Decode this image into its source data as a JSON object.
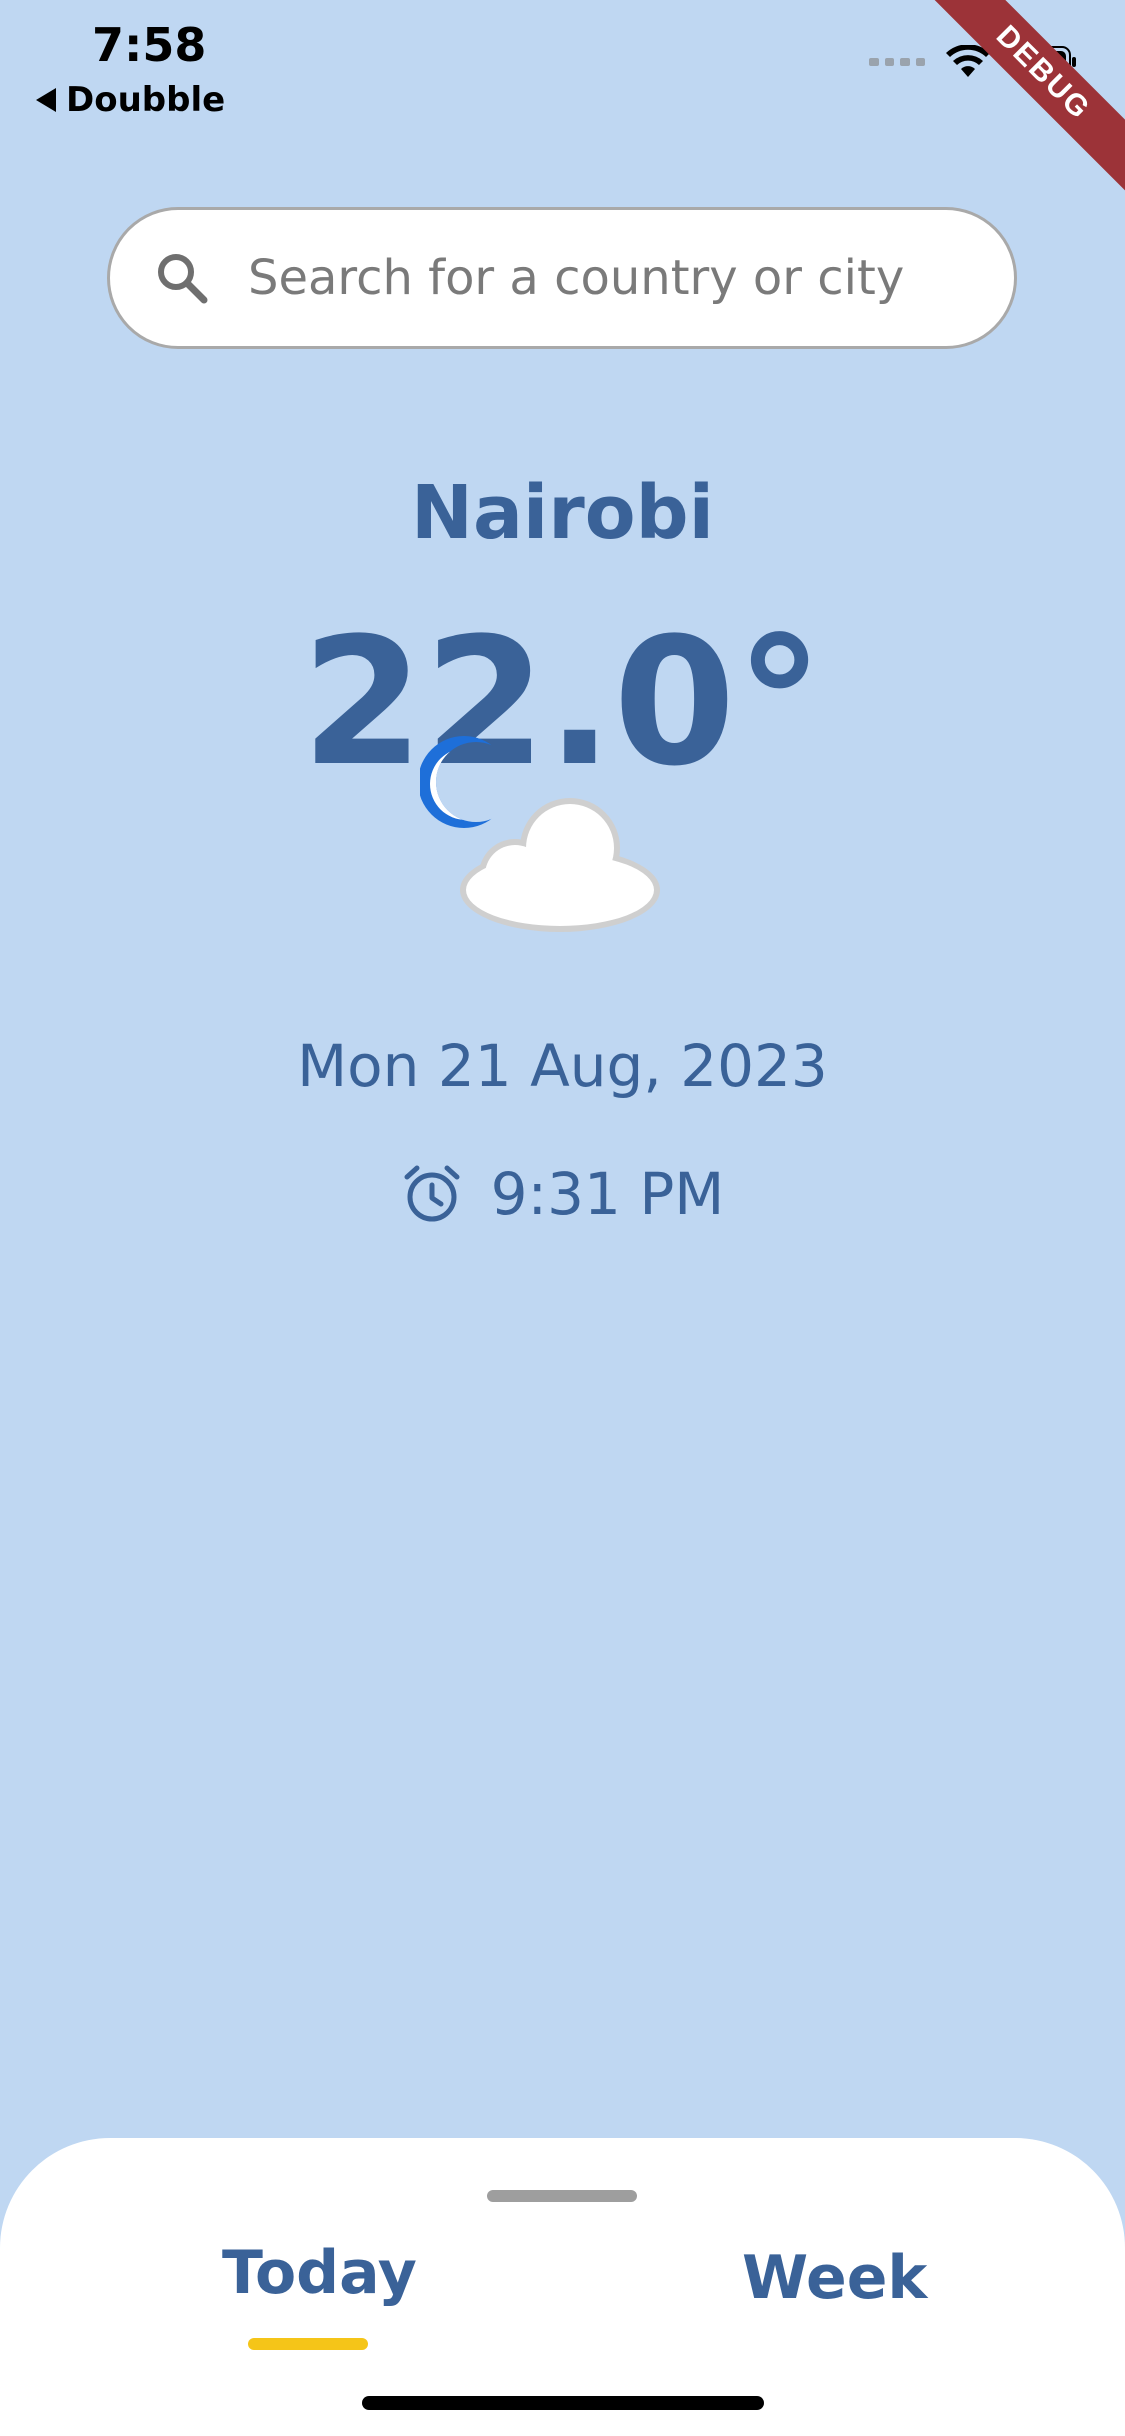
{
  "status_bar": {
    "time": "7:58",
    "back_label": "Doubble"
  },
  "debug_banner": "DEBUG",
  "search": {
    "placeholder": "Search for a country or city"
  },
  "weather": {
    "city": "Nairobi",
    "temperature": "22.0°",
    "condition_icon": "moon-cloud-icon",
    "date": "Mon 21 Aug, 2023",
    "time": "9:31 PM"
  },
  "bottom_sheet": {
    "tabs": [
      {
        "label": "Today",
        "selected": true
      },
      {
        "label": "Week",
        "selected": false
      }
    ],
    "indicator_color": "#F5C518"
  },
  "colors": {
    "background": "#BFD7F2",
    "primary_text": "#3A6298"
  }
}
